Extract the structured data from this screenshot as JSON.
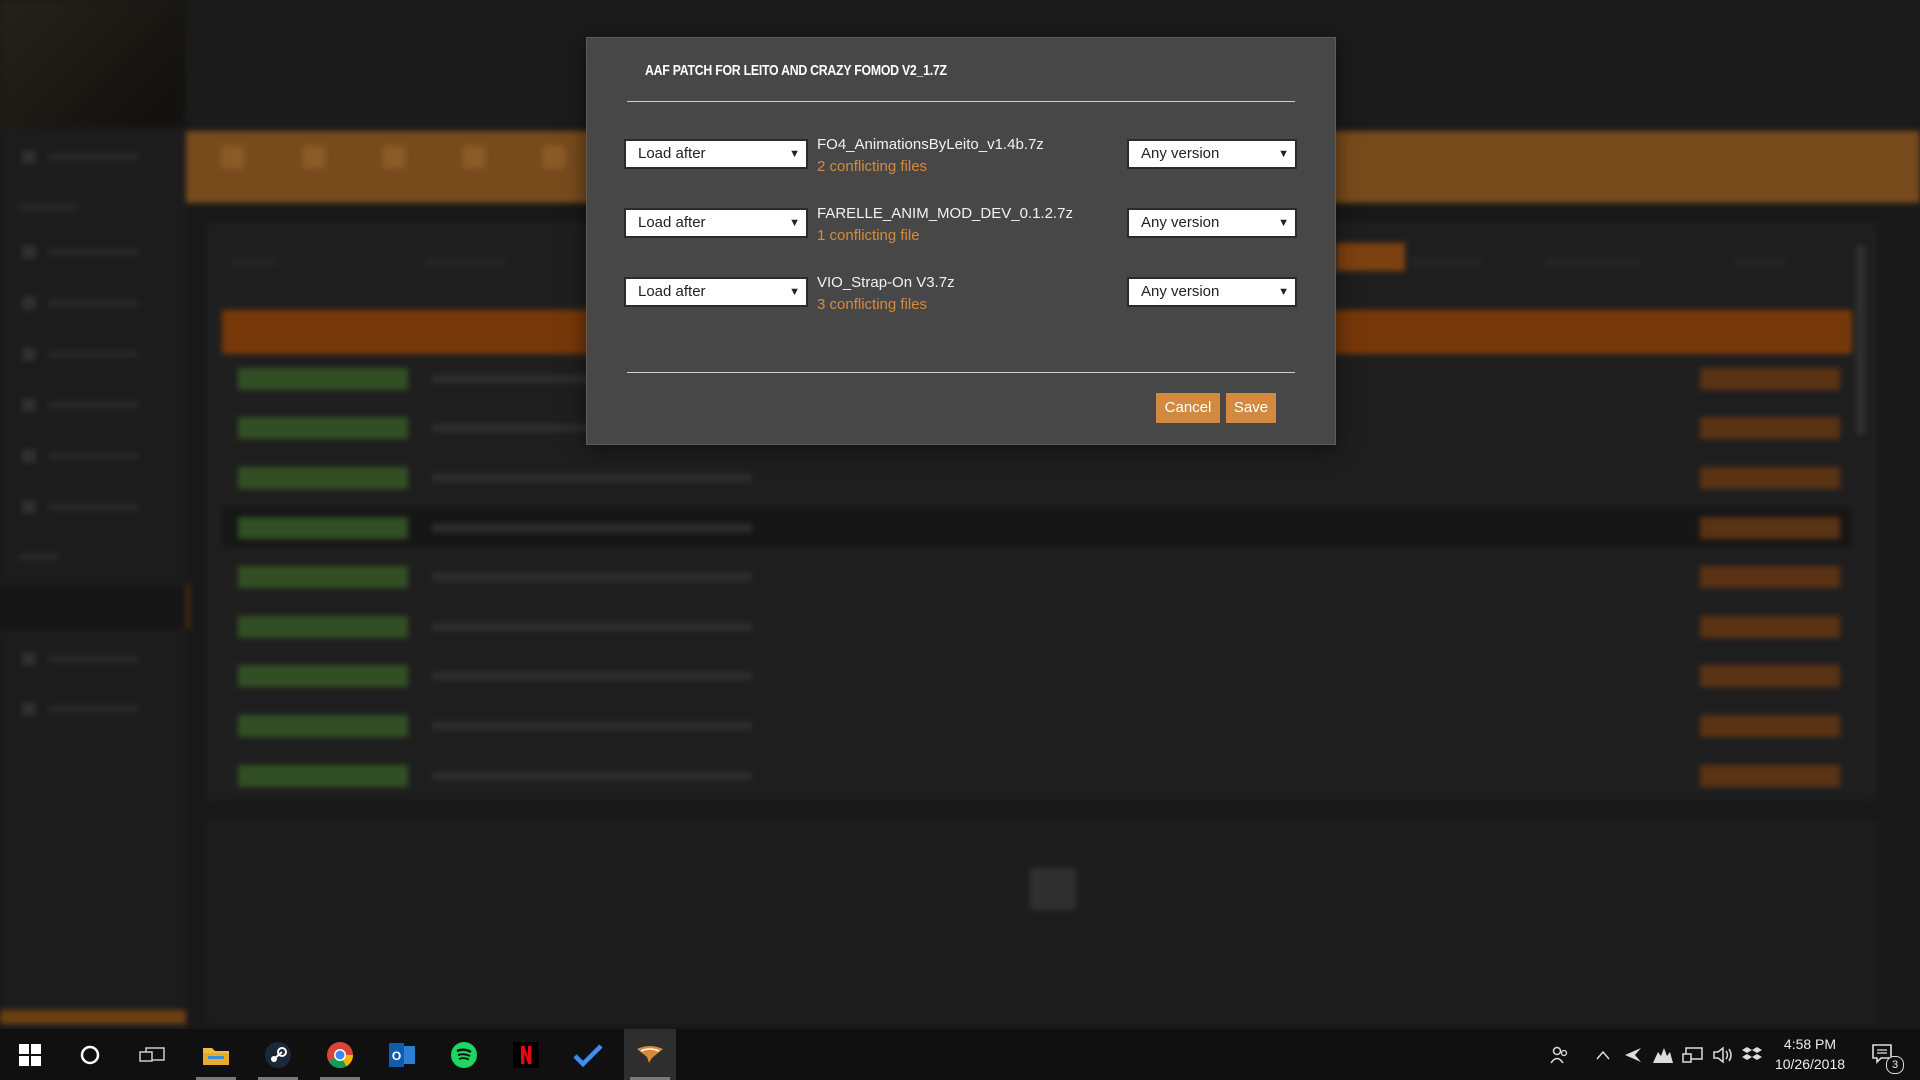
{
  "dialog": {
    "title": "AAF PATCH FOR LEITO AND CRAZY FOMOD V2_1.7Z",
    "rules": [
      {
        "order": "Load after",
        "mod": "FO4_AnimationsByLeito_v1.4b.7z",
        "conflicts": "2 conflicting files",
        "version": "Any version"
      },
      {
        "order": "Load after",
        "mod": "FARELLE_ANIM_MOD_DEV_0.1.2.7z",
        "conflicts": "1 conflicting file",
        "version": "Any version"
      },
      {
        "order": "Load after",
        "mod": "VIO_Strap-On V3.7z",
        "conflicts": "3 conflicting files",
        "version": "Any version"
      }
    ],
    "cancel_label": "Cancel",
    "save_label": "Save"
  },
  "taskbar": {
    "time": "4:58 PM",
    "date": "10/26/2018",
    "notification_count": "3",
    "apps": [
      "start-icon",
      "cortana-icon",
      "task-view-icon",
      "file-explorer-icon",
      "steam-icon",
      "chrome-icon",
      "outlook-icon",
      "spotify-icon",
      "netflix-icon",
      "todo-icon",
      "vortex-icon"
    ]
  },
  "colors": {
    "accent": "#d38a40",
    "conflict_text": "#d88a3c",
    "dialog_bg": "#474747"
  }
}
